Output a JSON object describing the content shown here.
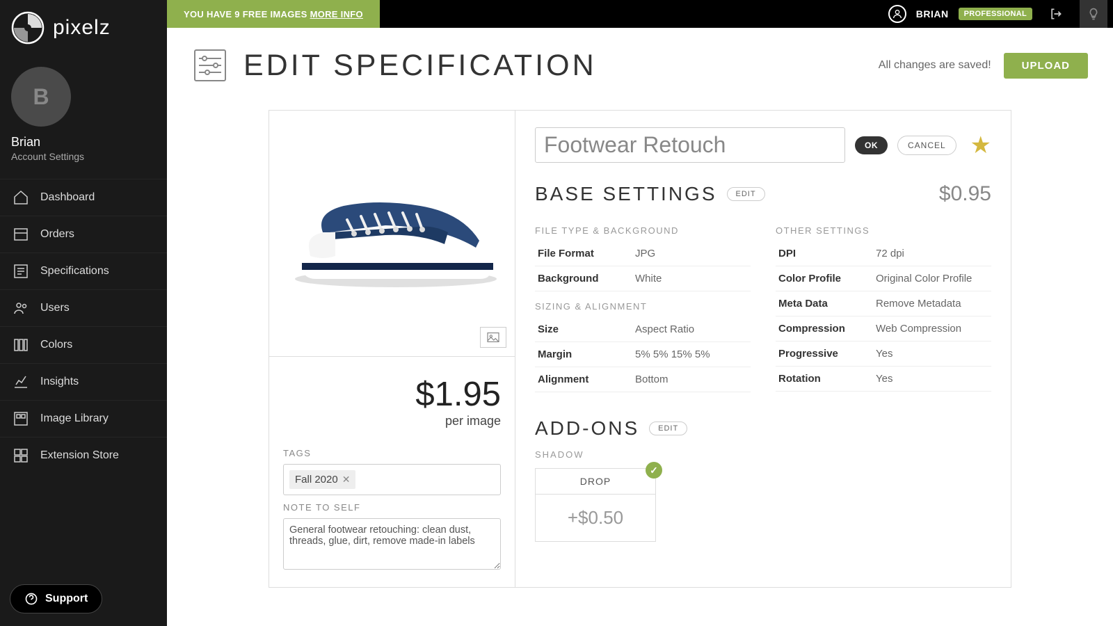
{
  "topbar": {
    "promo_text": "YOU HAVE 9 FREE IMAGES",
    "promo_link": "MORE INFO",
    "username": "BRIAN",
    "plan": "PROFESSIONAL"
  },
  "sidebar": {
    "logo_text": "pixelz",
    "avatar_initial": "B",
    "profile_name": "Brian",
    "profile_sub": "Account Settings",
    "nav": [
      {
        "label": "Dashboard"
      },
      {
        "label": "Orders"
      },
      {
        "label": "Specifications"
      },
      {
        "label": "Users"
      },
      {
        "label": "Colors"
      },
      {
        "label": "Insights"
      },
      {
        "label": "Image Library"
      },
      {
        "label": "Extension Store"
      }
    ],
    "support": "Support"
  },
  "header": {
    "title": "EDIT SPECIFICATION",
    "saved": "All changes are saved!",
    "upload": "UPLOAD"
  },
  "spec": {
    "name": "Footwear Retouch",
    "ok": "OK",
    "cancel": "CANCEL",
    "price": "$1.95",
    "price_sub": "per image",
    "tags_label": "TAGS",
    "tag": "Fall 2020",
    "note_label": "NOTE TO SELF",
    "note": "General footwear retouching: clean dust, threads, glue, dirt, remove made-in labels",
    "base": {
      "title": "BASE SETTINGS",
      "edit": "EDIT",
      "price": "$0.95",
      "group1": "FILE TYPE & BACKGROUND",
      "rows1": [
        {
          "k": "File Format",
          "v": "JPG"
        },
        {
          "k": "Background",
          "v": "White"
        }
      ],
      "group2": "SIZING & ALIGNMENT",
      "rows2": [
        {
          "k": "Size",
          "v": "Aspect Ratio"
        },
        {
          "k": "Margin",
          "v": "5% 5% 15% 5%"
        },
        {
          "k": "Alignment",
          "v": "Bottom"
        }
      ],
      "group3": "OTHER SETTINGS",
      "rows3": [
        {
          "k": "DPI",
          "v": "72 dpi"
        },
        {
          "k": "Color Profile",
          "v": "Original Color Profile"
        },
        {
          "k": "Meta Data",
          "v": "Remove Metadata"
        },
        {
          "k": "Compression",
          "v": "Web Compression"
        },
        {
          "k": "Progressive",
          "v": "Yes"
        },
        {
          "k": "Rotation",
          "v": "Yes"
        }
      ]
    },
    "addons": {
      "title": "ADD-ONS",
      "edit": "EDIT",
      "shadow_label": "SHADOW",
      "drop": "DROP",
      "drop_price": "+$0.50"
    }
  }
}
